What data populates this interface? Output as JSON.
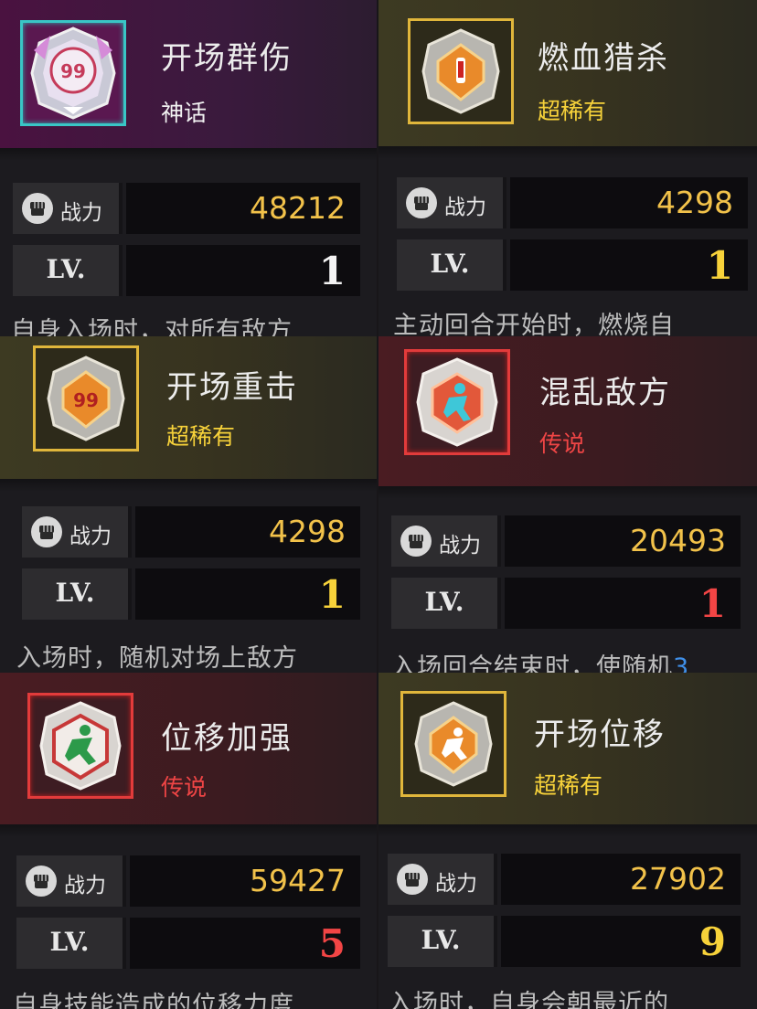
{
  "labels": {
    "power": "战力",
    "level": "LV."
  },
  "colors": {
    "mythic": "#39c6c6",
    "super_rare": "#e0b63b",
    "legendary": "#e23b3b",
    "power_value": "#f2c24a"
  },
  "cards": [
    {
      "name": "开场群伤",
      "rarity": "神话",
      "rarity_key": "mythic",
      "icon": "mythic-badge-icon",
      "power": "48212",
      "level": "1",
      "level_color": "white",
      "desc": "自身入场时，对所有敌方"
    },
    {
      "name": "燃血猎杀",
      "rarity": "超稀有",
      "rarity_key": "super_rare",
      "icon": "blood-sword-badge-icon",
      "power": "4298",
      "level": "1",
      "level_color": "gold",
      "desc": "主动回合开始时，燃烧自"
    },
    {
      "name": "开场重击",
      "rarity": "超稀有",
      "rarity_key": "super_rare",
      "icon": "heavy-strike-badge-icon",
      "power": "4298",
      "level": "1",
      "level_color": "gold",
      "desc": "入场时，随机对场上敌方"
    },
    {
      "name": "混乱敌方",
      "rarity": "传说",
      "rarity_key": "legendary",
      "icon": "chaos-runner-badge-icon",
      "power": "20493",
      "level": "1",
      "level_color": "red",
      "desc": "入场回合结束时，使随机",
      "desc_highlight": "3"
    },
    {
      "name": "位移加强",
      "rarity": "传说",
      "rarity_key": "legendary",
      "icon": "sprint-badge-icon",
      "power": "59427",
      "level": "5",
      "level_color": "red",
      "desc": "自身技能造成的位移力度"
    },
    {
      "name": "开场位移",
      "rarity": "超稀有",
      "rarity_key": "super_rare",
      "icon": "dash-badge-icon",
      "power": "27902",
      "level": "9",
      "level_color": "gold",
      "desc": "入场时，自身会朝最近的"
    }
  ]
}
